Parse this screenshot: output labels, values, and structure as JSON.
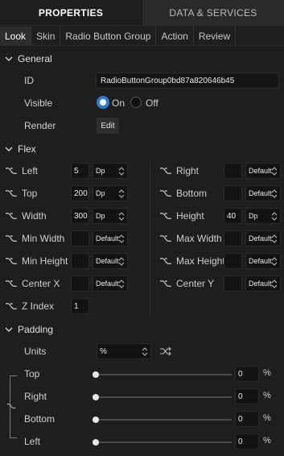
{
  "top_tabs": {
    "properties": "PROPERTIES",
    "data_services": "DATA & SERVICES"
  },
  "sub_tabs": [
    "Look",
    "Skin",
    "Radio Button Group",
    "Action",
    "Review"
  ],
  "general": {
    "title": "General",
    "id_label": "ID",
    "id_value": "RadioButtonGroup0bd87a820646b45",
    "visible_label": "Visible",
    "on_label": "On",
    "off_label": "Off",
    "render_label": "Render",
    "edit_label": "Edit"
  },
  "flex": {
    "title": "Flex",
    "left": {
      "label": "Left",
      "value": "5",
      "unit": "Dp"
    },
    "top": {
      "label": "Top",
      "value": "200",
      "unit": "Dp"
    },
    "width": {
      "label": "Width",
      "value": "300",
      "unit": "Dp"
    },
    "min_width": {
      "label": "Min Width",
      "value": "",
      "unit": "Default"
    },
    "min_height": {
      "label": "Min Height",
      "value": "",
      "unit": "Default"
    },
    "center_x": {
      "label": "Center X",
      "value": "",
      "unit": "Default"
    },
    "z_index": {
      "label": "Z Index",
      "value": "1"
    },
    "right": {
      "label": "Right",
      "value": "",
      "unit": "Default"
    },
    "bottom": {
      "label": "Bottom",
      "value": "",
      "unit": "Default"
    },
    "height": {
      "label": "Height",
      "value": "40",
      "unit": "Dp"
    },
    "max_width": {
      "label": "Max Width",
      "value": "",
      "unit": "Default"
    },
    "max_height": {
      "label": "Max Height",
      "value": "",
      "unit": "Default"
    },
    "center_y": {
      "label": "Center Y",
      "value": "",
      "unit": "Default"
    }
  },
  "padding": {
    "title": "Padding",
    "units_label": "Units",
    "units_value": "%",
    "top": {
      "label": "Top",
      "value": "0",
      "unit": "%",
      "level": 0
    },
    "right": {
      "label": "Right",
      "value": "0",
      "unit": "%",
      "level": 0
    },
    "bottom": {
      "label": "Bottom",
      "value": "0",
      "unit": "%",
      "level": 0
    },
    "left": {
      "label": "Left",
      "value": "0",
      "unit": "%",
      "level": 0
    }
  },
  "colors": {
    "accent": "#2f7bd6",
    "background": "#1e1e1e"
  },
  "icons": [
    "chevron-down-icon",
    "link-icon",
    "spinner-icon",
    "shuffle-icon"
  ]
}
